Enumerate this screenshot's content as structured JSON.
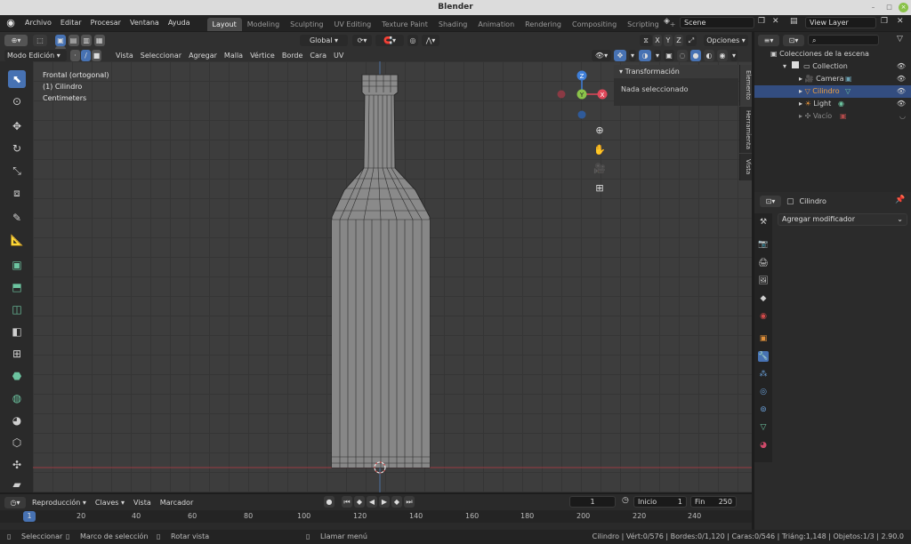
{
  "window": {
    "title": "Blender"
  },
  "menu": {
    "items": [
      "Archivo",
      "Editar",
      "Procesar",
      "Ventana",
      "Ayuda"
    ]
  },
  "workspace_tabs": [
    {
      "label": "Layout",
      "active": true
    },
    {
      "label": "Modeling"
    },
    {
      "label": "Sculpting"
    },
    {
      "label": "UV Editing"
    },
    {
      "label": "Texture Paint"
    },
    {
      "label": "Shading"
    },
    {
      "label": "Animation"
    },
    {
      "label": "Rendering"
    },
    {
      "label": "Compositing"
    },
    {
      "label": "Scripting"
    }
  ],
  "add_tab": "+",
  "scene": {
    "name": "Scene"
  },
  "view_layer": {
    "name": "View Layer"
  },
  "viewport_header": {
    "mode": "Modo Edición",
    "orientation": "Global",
    "axes": [
      "X",
      "Y",
      "Z"
    ],
    "options": "Opciones"
  },
  "viewport_menu": [
    "Vista",
    "Seleccionar",
    "Agregar",
    "Malla",
    "Vértice",
    "Borde",
    "Cara",
    "UV"
  ],
  "viewport_overlay": {
    "line1": "Frontal (ortogonal)",
    "line2": "(1) Cilindro",
    "line3": "Centimeters"
  },
  "npanel": {
    "title": "Transformación",
    "empty": "Nada seleccionado",
    "tabs": [
      "Elemento",
      "Herramienta",
      "Vista"
    ]
  },
  "gizmo": {
    "z": "Z",
    "y": "Y",
    "x": "X"
  },
  "outliner": {
    "root": "Colecciones de la escena",
    "items": [
      {
        "label": "Collection",
        "level": 1
      },
      {
        "label": "Camera",
        "level": 2
      },
      {
        "label": "Cilindro",
        "level": 2,
        "selected": true
      },
      {
        "label": "Light",
        "level": 2
      },
      {
        "label": "Vacío",
        "level": 2
      }
    ]
  },
  "properties": {
    "object_name": "Cilindro",
    "add_modifier": "Agregar modificador"
  },
  "timeline": {
    "menu": [
      "Reproducción",
      "Claves",
      "Vista",
      "Marcador"
    ],
    "current_frame": "1",
    "start_label": "Inicio",
    "start": "1",
    "end_label": "Fin",
    "end": "250",
    "ruler": [
      "1",
      "20",
      "40",
      "60",
      "80",
      "100",
      "120",
      "140",
      "160",
      "180",
      "200",
      "220",
      "240"
    ]
  },
  "statusbar": {
    "select": "Seleccionar",
    "box_select": "Marco de selección",
    "rotate": "Rotar vista",
    "menu": "Llamar menú",
    "stats": "Cilindro | Vért:0/576 | Bordes:0/1,120 | Caras:0/546 | Triáng:1,148 | Objetos:1/3 | 2.90.0"
  },
  "colors": {
    "accent": "#4772b3",
    "selected_row": "#334d80",
    "x_axis": "#e0485a",
    "y_axis": "#8bc34a",
    "z_axis": "#3f7fd9"
  }
}
